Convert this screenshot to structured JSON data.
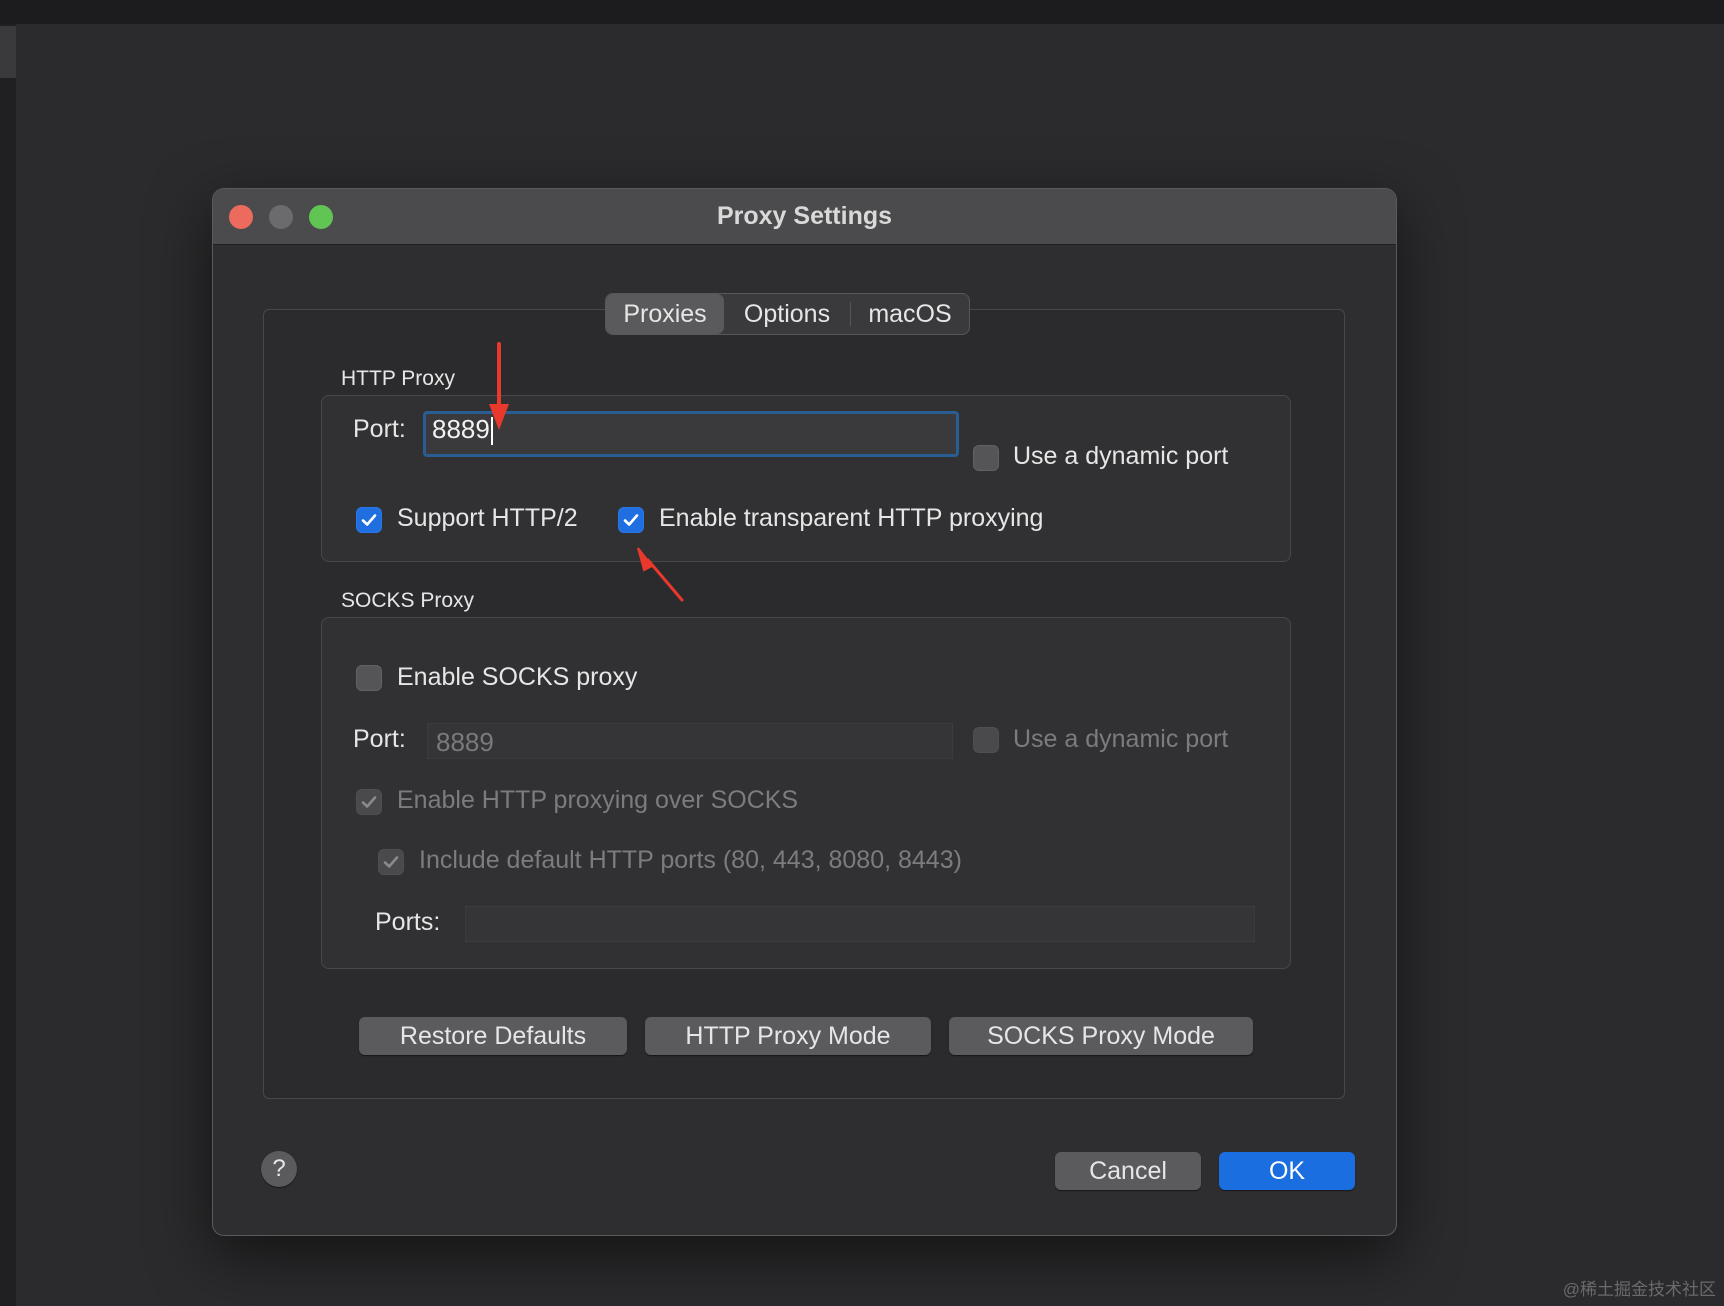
{
  "window": {
    "title": "Proxy Settings"
  },
  "tabs": [
    {
      "label": "Proxies",
      "active": true
    },
    {
      "label": "Options",
      "active": false
    },
    {
      "label": "macOS",
      "active": false
    }
  ],
  "http_proxy": {
    "group_label": "HTTP Proxy",
    "port_label": "Port:",
    "port_value": "8889",
    "dynamic_port_label": "Use a dynamic port",
    "dynamic_port_checked": false,
    "support_http2_label": "Support HTTP/2",
    "support_http2_checked": true,
    "transparent_label": "Enable transparent HTTP proxying",
    "transparent_checked": true
  },
  "socks_proxy": {
    "group_label": "SOCKS Proxy",
    "enable_label": "Enable SOCKS proxy",
    "enable_checked": false,
    "port_label": "Port:",
    "port_value": "8889",
    "dynamic_port_label": "Use a dynamic port",
    "http_over_socks_label": "Enable HTTP proxying over SOCKS",
    "http_over_socks_checked": true,
    "include_ports_label": "Include default HTTP ports (80, 443, 8080, 8443)",
    "include_ports_checked": true,
    "ports_label": "Ports:",
    "ports_value": ""
  },
  "buttons": {
    "restore_defaults": "Restore Defaults",
    "http_proxy_mode": "HTTP Proxy Mode",
    "socks_proxy_mode": "SOCKS Proxy Mode",
    "help": "?",
    "cancel": "Cancel",
    "ok": "OK"
  },
  "annotations": {
    "arrow_color": "#e8392c"
  },
  "watermark": "@稀土掘金技术社区",
  "colors": {
    "accent": "#1a6ee0",
    "background": "#2b2b2d"
  }
}
